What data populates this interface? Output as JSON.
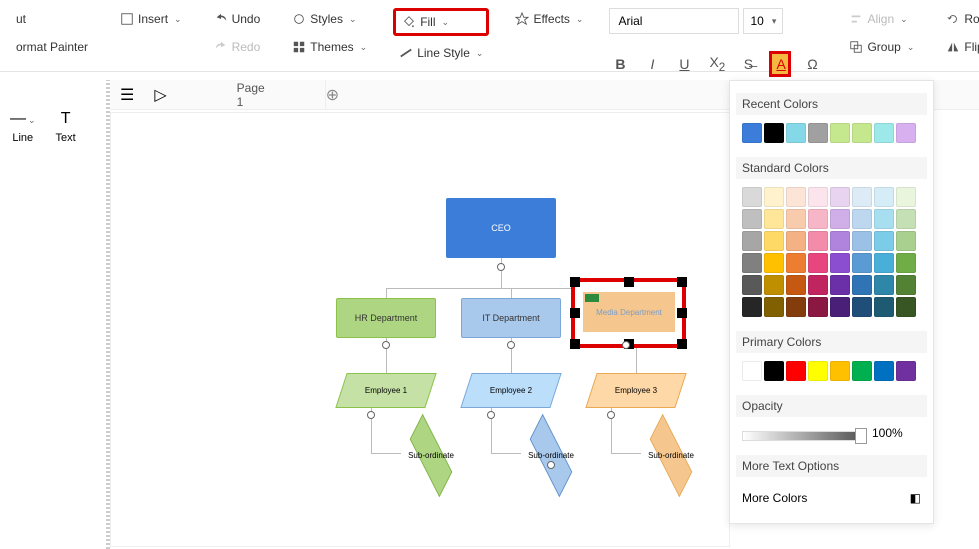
{
  "toolbar": {
    "format_painter": "ormat Painter",
    "insert": "Insert",
    "undo": "Undo",
    "redo": "Redo",
    "styles": "Styles",
    "themes": "Themes",
    "fill": "Fill",
    "line_style": "Line Style",
    "effects": "Effects",
    "font": "Arial",
    "size": "10",
    "align": "Align",
    "group": "Group",
    "rotate": "Rotate",
    "flip": "Flip",
    "cut": "ut"
  },
  "side": {
    "line": "Line",
    "text": "Text"
  },
  "page": {
    "tab": "Page 1"
  },
  "chart": {
    "ceo": "CEO",
    "hr": "HR Department",
    "it": "IT Department",
    "media": "Media Department",
    "emp1": "Employee 1",
    "emp2": "Employee 2",
    "emp3": "Employee 3",
    "sub": "Sub-ordinate"
  },
  "panel": {
    "recent": "Recent Colors",
    "standard": "Standard Colors",
    "primary": "Primary Colors",
    "opacity": "Opacity",
    "opacity_val": "100%",
    "more_text": "More Text Options",
    "more_colors": "More Colors",
    "recent_colors": [
      "#3b7dd8",
      "#000000",
      "#85d8e8",
      "#a0a0a0",
      "#c5e88e",
      "#c5e88e",
      "#9de8e8",
      "#d8b0f0"
    ],
    "standard_rows": [
      [
        "#d9d9d9",
        "#fff2cc",
        "#fce4d6",
        "#fce4ec",
        "#e8d4f0",
        "#ddebf7",
        "#d4edf7",
        "#eaf5dd"
      ],
      [
        "#bfbfbf",
        "#ffe699",
        "#f8cbad",
        "#f7b6c8",
        "#d0aee8",
        "#bdd7ee",
        "#a8dff0",
        "#c5e0b4"
      ],
      [
        "#a6a6a6",
        "#ffd966",
        "#f4b183",
        "#f38bab",
        "#b084dc",
        "#9bc2e6",
        "#7bcce8",
        "#a9d08e"
      ],
      [
        "#808080",
        "#ffc000",
        "#ed7d31",
        "#e8467f",
        "#8c4ed0",
        "#5b9bd5",
        "#4aafd8",
        "#70ad47"
      ],
      [
        "#595959",
        "#bf8f00",
        "#c65911",
        "#c0255f",
        "#6b2fa8",
        "#2f75b5",
        "#2e86a8",
        "#548235"
      ],
      [
        "#262626",
        "#806000",
        "#833c0c",
        "#8a1843",
        "#4a1f78",
        "#1f4e78",
        "#1e5b73",
        "#375623"
      ]
    ],
    "primary_row": [
      "#ffffff",
      "#000000",
      "#ff0000",
      "#ffff00",
      "#ffc000",
      "#00b050",
      "#0070c0",
      "#7030a0"
    ]
  }
}
